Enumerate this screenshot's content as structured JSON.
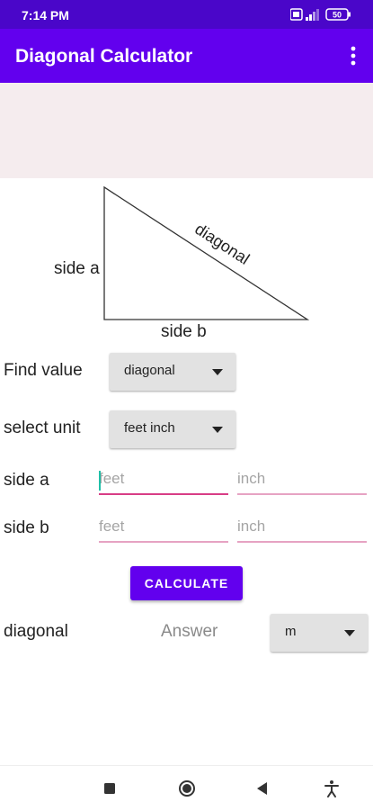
{
  "status_bar": {
    "time": "7:14 PM",
    "battery": "50"
  },
  "app_bar": {
    "title": "Diagonal Calculator"
  },
  "diagram": {
    "side_a": "side a",
    "side_b": "side b",
    "diagonal": "diagonal"
  },
  "form": {
    "find_value": {
      "label": "Find value",
      "selected": "diagonal"
    },
    "select_unit": {
      "label": "select unit",
      "selected": "feet inch"
    },
    "side_a": {
      "label": "side a",
      "feet_placeholder": "feet",
      "inch_placeholder": "inch"
    },
    "side_b": {
      "label": "side b",
      "feet_placeholder": "feet",
      "inch_placeholder": "inch"
    },
    "calculate_label": "CALCULATE",
    "result": {
      "label": "diagonal",
      "answer": "Answer",
      "unit_selected": "m"
    }
  },
  "colors": {
    "primary": "#6200ee",
    "status_bar": "#4a06c9",
    "accent": "#d83d86",
    "ad_background": "#f5ecee"
  }
}
